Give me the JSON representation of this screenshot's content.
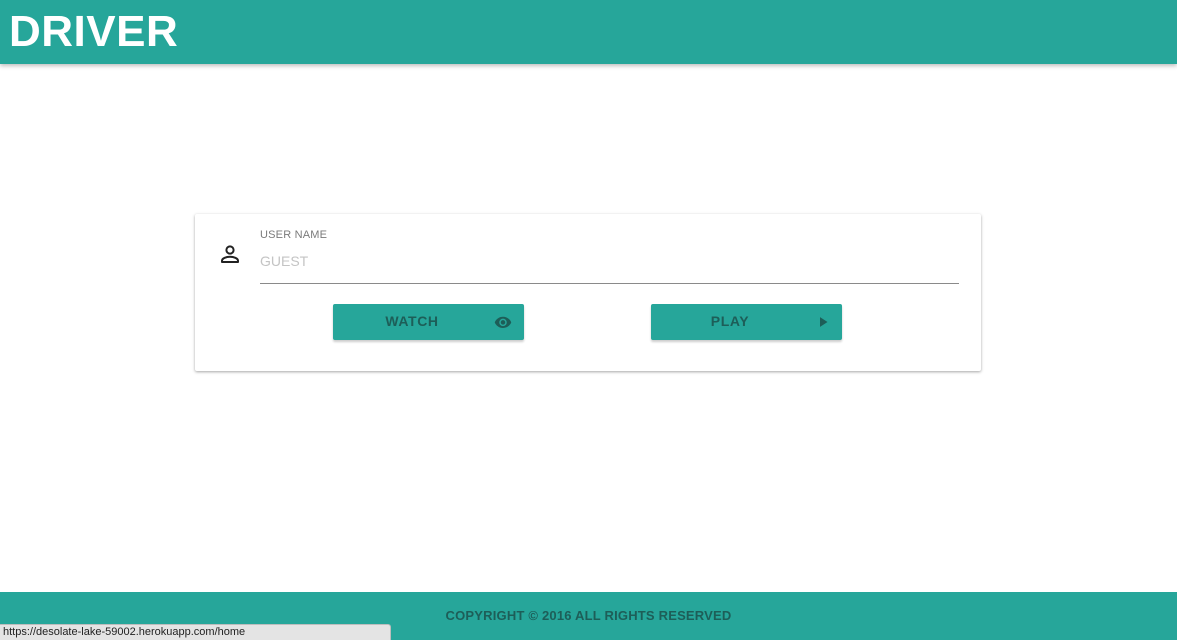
{
  "header": {
    "title": "DRIVER"
  },
  "login_card": {
    "user_icon": "person-icon",
    "field_label": "USER NAME",
    "field_value": "",
    "field_placeholder": "GUEST",
    "watch_button": {
      "label": "WATCH",
      "icon": "eye-icon"
    },
    "play_button": {
      "label": "PLAY",
      "icon": "play-icon"
    }
  },
  "footer": {
    "copyright": "COPYRIGHT © 2016 ALL RIGHTS RESERVED"
  },
  "status_bar": {
    "url": "https://desolate-lake-59002.herokuapp.com/home"
  },
  "colors": {
    "primary": "#26a69a",
    "button_text": "#1d5e58"
  }
}
